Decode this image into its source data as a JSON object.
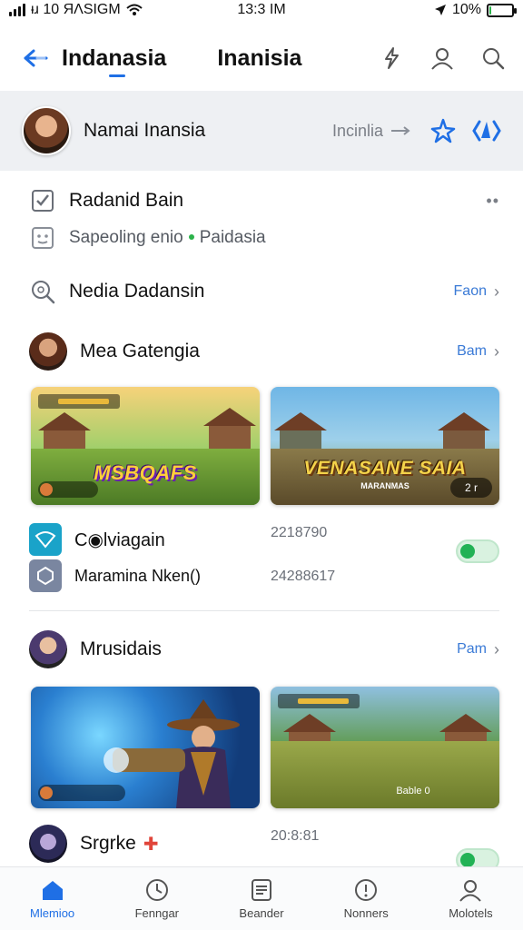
{
  "status": {
    "left": "ᵻɹ 10 ЯɅSIGM",
    "time": "13:3 IM",
    "battery": "10%",
    "battery_level": 0.1
  },
  "header": {
    "title": "Indanasia",
    "subtitle": "Inanisia",
    "icons": [
      "back-arrow-icon",
      "share-icon",
      "user-icon",
      "search-icon"
    ]
  },
  "profile": {
    "name": "Namai Inansia",
    "meta": "Incinlia",
    "actions": [
      "pin-icon",
      "broadcast-icon"
    ]
  },
  "rows": {
    "task": {
      "label": "Radanid Bain"
    },
    "sub": {
      "label": "Sapeoling enio",
      "extra": "Paidasia"
    },
    "search": {
      "label": "Nedia Dadansin",
      "action": "Faon"
    }
  },
  "section1": {
    "title": "Mea Gatengia",
    "action": "Bam",
    "cards": [
      {
        "logo": "MSBQAFS",
        "corner": ""
      },
      {
        "logo": "VENASANE SAIA",
        "sub": "MARANMAS",
        "corner": "2 r"
      }
    ]
  },
  "list": {
    "items": [
      {
        "label": "C◉lviagain",
        "num": "2218790",
        "toggle": true
      },
      {
        "label": "Maramina Nken()",
        "num": "24288617"
      }
    ]
  },
  "section2": {
    "title": "Mrusidais",
    "action": "Pam",
    "cards": [
      {
        "corner": ""
      },
      {
        "corner": "Bable 0"
      }
    ],
    "next": {
      "label": "Srgrke",
      "num": "20:8:81"
    }
  },
  "nav": [
    {
      "label": "Mlemioo",
      "icon": "home-icon",
      "active": true
    },
    {
      "label": "Fenngar",
      "icon": "clock-icon",
      "active": false
    },
    {
      "label": "Beander",
      "icon": "grid-icon",
      "active": false
    },
    {
      "label": "Nonners",
      "icon": "bell-icon",
      "active": false
    },
    {
      "label": "Molotels",
      "icon": "person-icon",
      "active": false
    }
  ],
  "colors": {
    "accent": "#1f6fe5",
    "toggle_on": "#22b255",
    "profile_bg": "#eef0f3"
  }
}
